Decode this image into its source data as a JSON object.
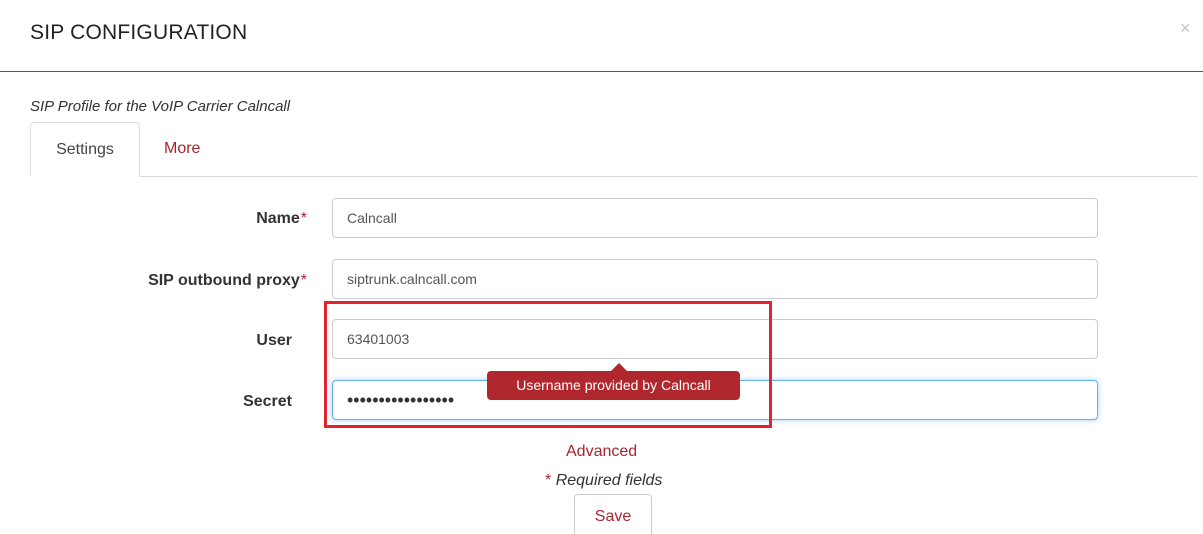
{
  "dialog": {
    "title": "SIP CONFIGURATION",
    "close_glyph": "×",
    "subtitle": "SIP Profile for the VoIP Carrier Calncall"
  },
  "tabs": [
    {
      "label": "Settings",
      "active": true
    },
    {
      "label": "More",
      "active": false
    }
  ],
  "form": {
    "required_marker": "*",
    "fields": [
      {
        "label": "Name",
        "required": true,
        "value": "Calncall",
        "type": "text"
      },
      {
        "label": "SIP outbound proxy",
        "required": true,
        "value": "siptrunk.calncall.com",
        "type": "text"
      },
      {
        "label": "User",
        "required": false,
        "value": "63401003",
        "type": "text"
      },
      {
        "label": "Secret",
        "required": false,
        "value": "abcdefghijklmnopq",
        "type": "password"
      }
    ],
    "tooltip": "Username provided by Calncall",
    "advanced_link": "Advanced",
    "required_note": "Required fields",
    "save_label": "Save"
  },
  "colors": {
    "accent": "#a8262b",
    "tooltip_bg": "#b0282e",
    "highlight_border": "#e3232e",
    "focus_border": "#66afe9"
  }
}
